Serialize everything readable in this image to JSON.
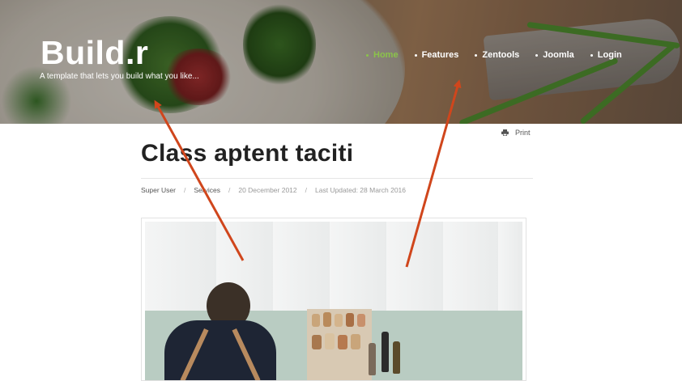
{
  "header": {
    "brand": "Build.r",
    "tagline": "A template that lets you build what you like...",
    "nav": [
      {
        "label": "Home",
        "active": true
      },
      {
        "label": "Features",
        "active": false
      },
      {
        "label": "Zentools",
        "active": false
      },
      {
        "label": "Joomla",
        "active": false
      },
      {
        "label": "Login",
        "active": false
      }
    ],
    "accent_color": "#8bc34a"
  },
  "article": {
    "print_label": "Print",
    "print_icon": "printer-icon",
    "title": "Class aptent taciti",
    "meta": {
      "author": "Super User",
      "category": "Services",
      "published": "20 December 2012",
      "updated": "Last Updated: 28 March 2016",
      "separator": "/"
    }
  },
  "annotation": {
    "arrow_color": "#d0461c"
  }
}
